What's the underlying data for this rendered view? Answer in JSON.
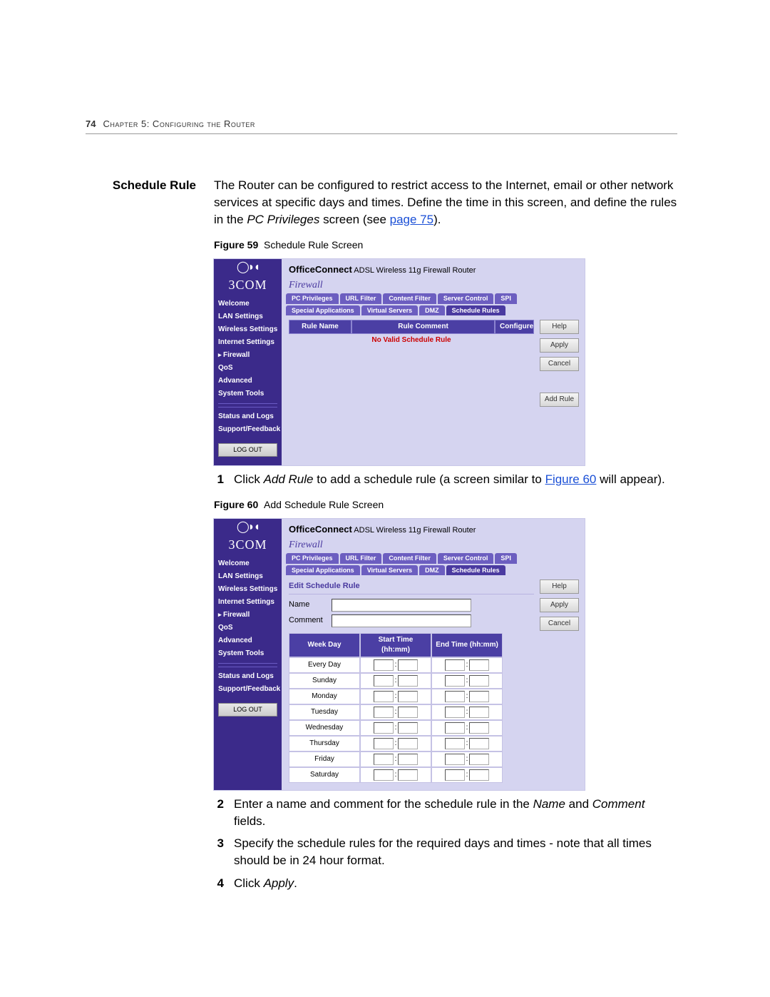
{
  "page_number": "74",
  "chapter_line": "Chapter 5: Configuring the Router",
  "section_heading": "Schedule Rule",
  "intro_para_1": "The Router can be configured to restrict access to the Internet, email or other network services at specific days and times. Define the time in this screen, and define the rules in the ",
  "intro_para_italic": "PC Privileges",
  "intro_para_2": " screen (see ",
  "intro_para_link": "page 75",
  "intro_para_3": ").",
  "fig59_label": "Figure 59",
  "fig59_caption": "Schedule Rule Screen",
  "fig60_label": "Figure 60",
  "fig60_caption": "Add Schedule Rule Screen",
  "step1_pre": "Click ",
  "step1_it": "Add Rule",
  "step1_mid": " to add a schedule rule (a screen similar to ",
  "step1_link": "Figure 60",
  "step1_post": " will appear).",
  "step2_pre": "Enter a name and comment for the schedule rule in the ",
  "step2_it1": "Name",
  "step2_mid": " and ",
  "step2_it2": "Comment",
  "step2_post": " fields.",
  "step3": "Specify the schedule rules for the required days and times - note that all times should be in 24 hour format.",
  "step4_pre": "Click ",
  "step4_it": "Apply",
  "step4_post": ".",
  "router": {
    "brand": "3COM",
    "product_bold": "OfficeConnect",
    "product_sub": "ADSL Wireless 11g Firewall Router",
    "section": "Firewall",
    "nav": [
      "Welcome",
      "LAN Settings",
      "Wireless Settings",
      "Internet Settings",
      "Firewall",
      "QoS",
      "Advanced",
      "System Tools",
      "Status and Logs",
      "Support/Feedback"
    ],
    "logout": "LOG OUT",
    "tabs_row1": [
      "PC Privileges",
      "URL Filter",
      "Content Filter",
      "Server Control"
    ],
    "tabs_row2": [
      "SPI",
      "Special Applications",
      "Virtual Servers",
      "DMZ",
      "Schedule Rules"
    ],
    "btns": {
      "help": "Help",
      "apply": "Apply",
      "cancel": "Cancel",
      "add_rule": "Add Rule"
    },
    "table_cols": {
      "rule_name": "Rule Name",
      "rule_comment": "Rule Comment",
      "configure": "Configure"
    },
    "no_valid": "No Valid Schedule Rule",
    "edit_title": "Edit Schedule Rule",
    "form": {
      "name_label": "Name",
      "comment_label": "Comment"
    },
    "sched_cols": {
      "day": "Week Day",
      "start": "Start Time (hh:mm)",
      "end": "End Time (hh:mm)"
    },
    "days": [
      "Every Day",
      "Sunday",
      "Monday",
      "Tuesday",
      "Wednesday",
      "Thursday",
      "Friday",
      "Saturday"
    ]
  }
}
